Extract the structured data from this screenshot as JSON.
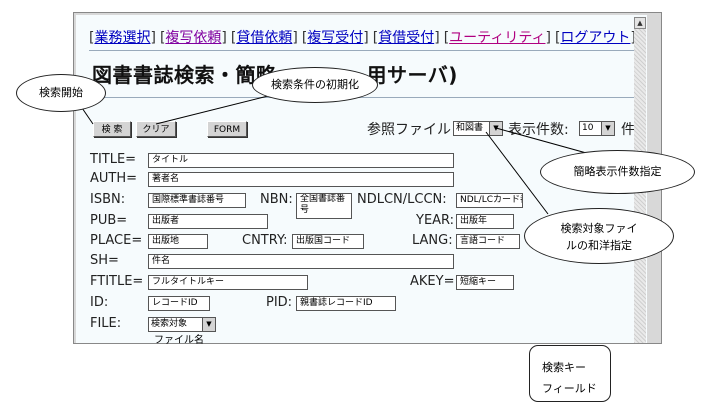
{
  "menu": {
    "items": [
      {
        "label": "業務選択",
        "state": "normal"
      },
      {
        "label": "複写依頼",
        "state": "active"
      },
      {
        "label": "貸借依頼",
        "state": "normal"
      },
      {
        "label": "複写受付",
        "state": "normal"
      },
      {
        "label": "貸借受付",
        "state": "normal"
      },
      {
        "label": "ユーティリティ",
        "state": "visited"
      },
      {
        "label": "ログアウト",
        "state": "normal"
      }
    ]
  },
  "page_title": "図書書誌検索・簡略",
  "page_title_tail": "用サーバ)",
  "toolbar": {
    "search_label": "検 索",
    "clear_label": "クリア",
    "form_label": "FORM",
    "ref_file_label": "参照ファイル",
    "ref_file_value": "和図書",
    "count_label": "表示件数:",
    "count_value": "10",
    "count_unit": "件"
  },
  "form": {
    "title": {
      "label": "TITLE=",
      "value": "タイトル"
    },
    "auth": {
      "label": "AUTH=",
      "value": "著者名"
    },
    "isbn": {
      "label": "ISBN:",
      "value": "国際標準書誌番号"
    },
    "nbn": {
      "label": "NBN:",
      "value": "全国書誌番号"
    },
    "ndlcn": {
      "label": "NDLCN/LCCN:",
      "value": "NDL/LCカード番号"
    },
    "pub": {
      "label": "PUB=",
      "value": "出版者"
    },
    "year": {
      "label": "YEAR:",
      "value": "出版年"
    },
    "place": {
      "label": "PLACE=",
      "value": "出版地"
    },
    "cntry": {
      "label": "CNTRY:",
      "value": "出版国コード"
    },
    "lang": {
      "label": "LANG:",
      "value": "言語コード"
    },
    "sh": {
      "label": "SH=",
      "value": "件名"
    },
    "ftitle": {
      "label": "FTITLE=",
      "value": "フルタイトルキー"
    },
    "akey": {
      "label": "AKEY=",
      "value": "短縮キー"
    },
    "id": {
      "label": "ID:",
      "value": "レコードID"
    },
    "pid": {
      "label": "PID:",
      "value": "親書誌レコードID"
    },
    "file": {
      "label": "FILE:",
      "value": "検索対象",
      "note": "ファイル名"
    }
  },
  "callouts": {
    "search_start": "検索開始",
    "reset_conditions": "検索条件の初期化",
    "display_count": "簡略表示件数指定",
    "target_file_line1": "検索対象ファイ",
    "target_file_line2": "ルの和洋指定",
    "search_key_line1": "検索キー",
    "search_key_line2": "フィールド"
  }
}
